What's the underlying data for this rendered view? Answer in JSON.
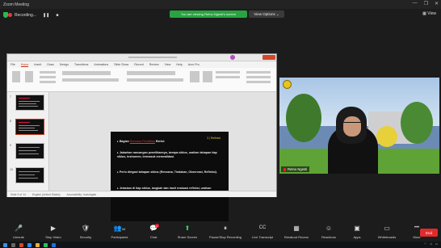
{
  "window": {
    "title": "Zoom Meeting",
    "controls": [
      "—",
      "❐",
      "✕"
    ]
  },
  "meeting": {
    "recording_label": "Recording...",
    "share_banner": "You are viewing Retno Ngesti's screen",
    "view_options_label": "View Options ⌄",
    "view_label": "View"
  },
  "powerpoint": {
    "menu": [
      "File",
      "Home",
      "Insert",
      "Draw",
      "Design",
      "Transitions",
      "Animations",
      "Slide Show",
      "Record",
      "Review",
      "View",
      "Help",
      "Acro Pro"
    ],
    "active_menu": "Home",
    "slide": {
      "tag": "3 | Refleksi",
      "bullets": [
        {
          "lead": "Bagian ",
          "highlight": "Rencana Penelitian",
          "rest": " Berisi:"
        },
        {
          "lead": "",
          "highlight": "",
          "rest": "Jabarkan rancangan penelitiannya, berapa siklus, uraikan tahapan tiap siklus, instrumen, termasuk memvalidasi."
        },
        {
          "lead": "",
          "highlight": "",
          "rest": "Perlu dirigasi tahapan siklus (Rencana, Tindakan, Observasi, Refleksi)."
        },
        {
          "lead": "",
          "highlight": "",
          "rest": "Jelaskan di tiap siklus, langkah dan hasil evaluasi refleksi, uraikan tindakan selanjutnya, dan indikator keberhasilannya"
        }
      ]
    },
    "notes_placeholder": "Click to add notes",
    "status": [
      "Slide 9 of 14",
      "English (United States)",
      "Accessibility: Investigate"
    ]
  },
  "video": {
    "participant_name": "Retno Ngesti"
  },
  "toolbar": {
    "buttons": [
      {
        "label": "Unmute",
        "icon": "🎤"
      },
      {
        "label": "Stop Video",
        "icon": "▶"
      },
      {
        "label": "Security",
        "icon": "🛡"
      },
      {
        "label": "Participants",
        "icon": "👥",
        "count": "34"
      },
      {
        "label": "Chat",
        "icon": "💬",
        "badge": "1"
      },
      {
        "label": "Share Screen",
        "icon": "⬆",
        "green": true
      },
      {
        "label": "Pause/Stop Recording",
        "icon": "⏸"
      },
      {
        "label": "Live Transcript",
        "icon": "CC"
      },
      {
        "label": "Breakout Rooms",
        "icon": "▦"
      },
      {
        "label": "Reactions",
        "icon": "☺"
      },
      {
        "label": "Apps",
        "icon": "▣"
      },
      {
        "label": "Whiteboards",
        "icon": "▭"
      },
      {
        "label": "More",
        "icon": "•••"
      }
    ],
    "end_label": "End"
  }
}
